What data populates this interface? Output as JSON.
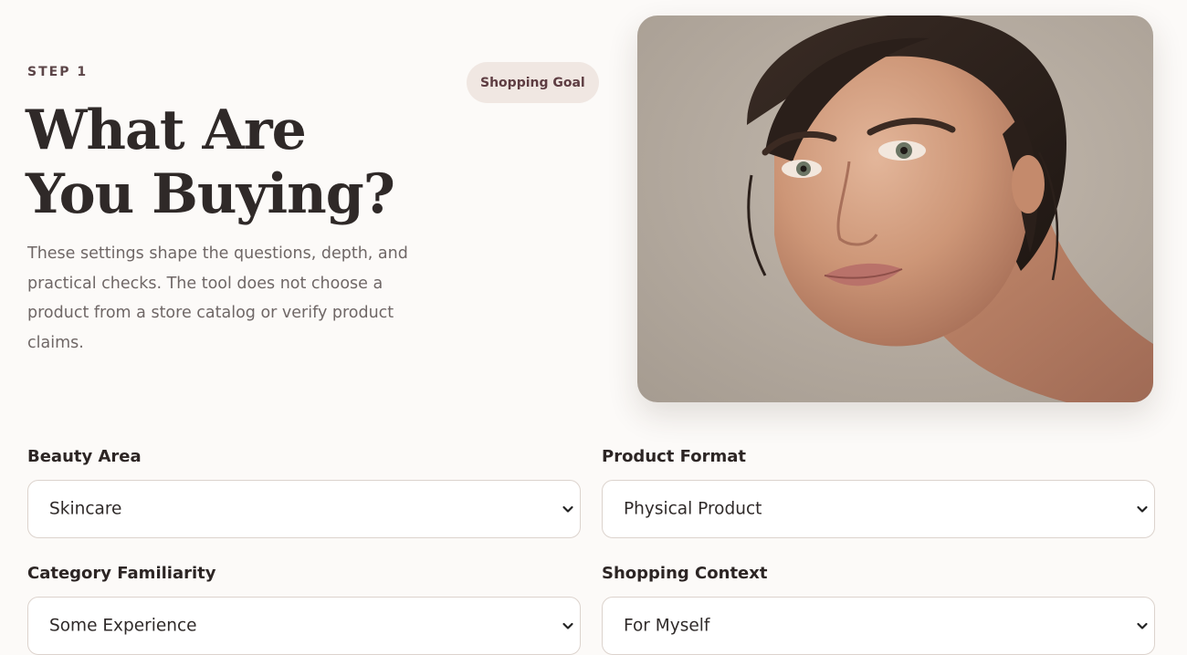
{
  "step": {
    "label": "STEP 1"
  },
  "hero": {
    "title_line1": "What Are",
    "title_line2": "You Buying?",
    "description": "These settings shape the questions, depth, and practical checks. The tool does not choose a product from a store catalog or verify product claims."
  },
  "badge": {
    "label": "Shopping Goal"
  },
  "image": {
    "alt": "Portrait of a woman with dark hair pulled back"
  },
  "fields": {
    "beauty_area": {
      "label": "Beauty Area",
      "value": "Skincare"
    },
    "product_format": {
      "label": "Product Format",
      "value": "Physical Product"
    },
    "category_familiarity": {
      "label": "Category Familiarity",
      "value": "Some Experience"
    },
    "shopping_context": {
      "label": "Shopping Context",
      "value": "For Myself"
    }
  },
  "icons": {
    "select_caret": "chevron-down-icon"
  },
  "colors": {
    "background": "#fcfaf8",
    "badge_bg": "#f0e7e2",
    "badge_text": "#5e3d42",
    "heading": "#2f2928",
    "body_text": "#6f6766",
    "select_border": "#dcd3cd"
  }
}
